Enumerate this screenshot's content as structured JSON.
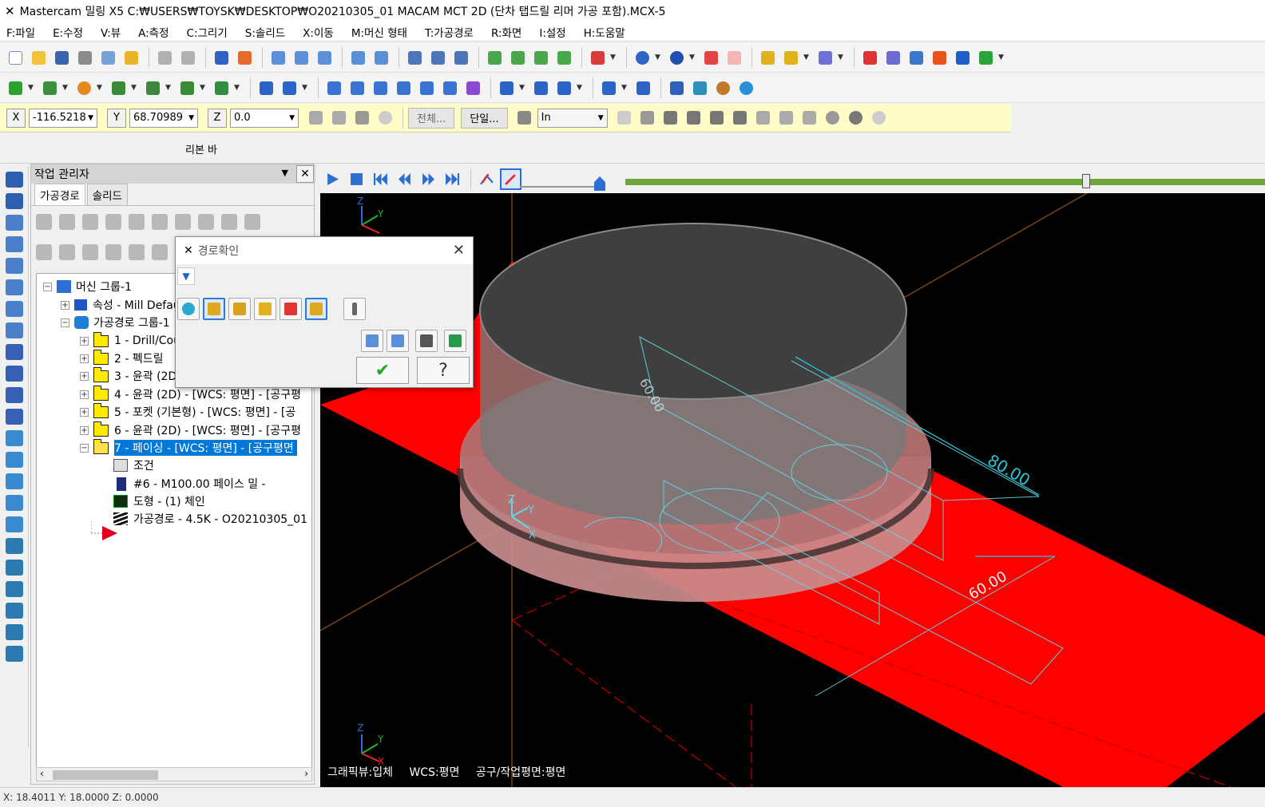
{
  "window": {
    "title": "Mastercam 밀링 X5  C:₩USERS₩TOYSK₩DESKTOP₩O20210305_01 MACAM MCT 2D (단차 탭드릴 리머 가공 포함).MCX-5"
  },
  "menu": [
    "F:파일",
    "E:수정",
    "V:뷰",
    "A:측정",
    "C:그리기",
    "S:솔리드",
    "X:이동",
    "M:머신 형태",
    "T:가공경로",
    "R:화면",
    "I:설정",
    "H:도움말"
  ],
  "coords": {
    "x_label": "X",
    "x_value": "-116.5218",
    "y_label": "Y",
    "y_value": "68.70989",
    "z_label": "Z",
    "z_value": "0.0",
    "btn_all": "전체...",
    "btn_single": "단일...",
    "unit_value": "In"
  },
  "ribbon": {
    "label": "리본 바"
  },
  "ops_manager": {
    "title": "작업 관리자",
    "tabs": [
      "가공경로",
      "솔리드"
    ],
    "tree": [
      "머신 그룹-1",
      "속성 - Mill Default",
      "가공경로 그룹-1",
      "1 - Drill/Counterbore",
      "2 - 펙드릴",
      "3 - 윤곽 (2D)",
      "4 - 윤곽 (2D) - [WCS: 평면] - [공구평",
      "5 - 포켓 (기본형) - [WCS: 평면] - [공",
      "6 - 윤곽 (2D) - [WCS: 평면] - [공구평",
      "7 - 페이싱 - [WCS: 평면] - [공구평면",
      "조건",
      "#6 - M100.00 페이스 밀 -",
      "도형 - (1) 체인",
      "가공경로 - 4.5K - O20210305_01"
    ]
  },
  "dialog": {
    "title": "경로확인"
  },
  "viewport": {
    "hud_graphics": "그래픽뷰:입체",
    "hud_wcs": "WCS:평면",
    "hud_tool": "공구/작업평면:평면",
    "dim_80": "80.00",
    "dim_60": "60.00",
    "dim_top": "60.00",
    "axis_x": "X",
    "axis_y": "Y",
    "axis_z": "Z"
  },
  "statusbar": {
    "text": "X: 18.4011   Y: 18.0000   Z: 0.0000"
  },
  "colors": {
    "accent": "#0078d7",
    "stock_red": "#ff0000",
    "progress": "#6ea63a"
  }
}
